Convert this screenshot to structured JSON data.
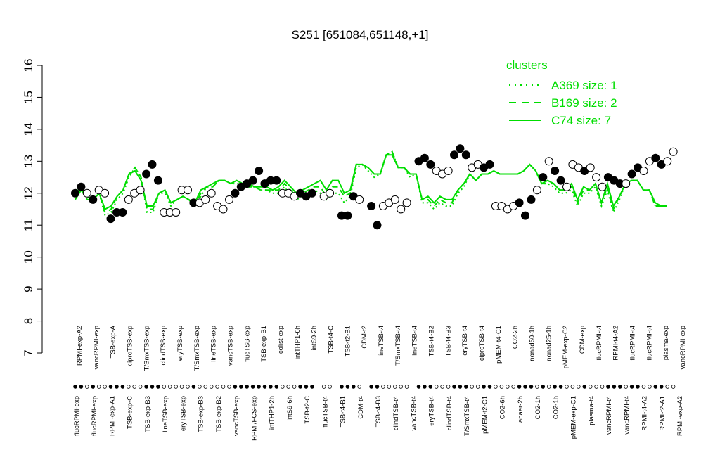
{
  "chart_data": {
    "type": "line",
    "title": "S251 [651084,651148,+1]",
    "xlabel": "",
    "ylabel": "",
    "ylim": [
      7,
      16
    ],
    "yticks": [
      "7",
      "8",
      "9",
      "10",
      "11",
      "12",
      "13",
      "14",
      "15",
      "16"
    ],
    "grid": false,
    "legend_position": "top-right",
    "colors": {
      "lines": "#00dd00",
      "points": "#000000",
      "open_points": "#ffffff"
    },
    "legend": {
      "title": "clusters",
      "entries": [
        {
          "label": "A369 size: 1",
          "style": "dotted"
        },
        {
          "label": "B169 size: 2",
          "style": "dashed"
        },
        {
          "label": "C74 size: 7",
          "style": "solid"
        }
      ]
    },
    "top_labels": [
      "RPMI-exp-A2",
      "vancRPMI-exp",
      "TSB-exp-A",
      "ciproTSB-exp",
      "T/SmxTSB-exp",
      "clindTSB-exp",
      "eryTSB-exp",
      "T/SmxTSB-exp",
      "lineTSB-exp",
      "vancTSB-exp",
      "flucTSB-exp",
      "TSB-exp-B1",
      "colist-exp",
      "intTHP1-6h",
      "intS9-2h",
      "TSB-t4-C",
      "TSB-t2-B1",
      "CDM-t2",
      "lineTSB-t4",
      "T/SmxTSB-t4",
      "lineTSB-t4",
      "TSB-t4-B2",
      "TSB-t4-B3",
      "eryTSB-t4",
      "ciproTSB-t4",
      "pMEM-t4-C1",
      "CO2-2h",
      "nonad50-1h",
      "nonad25-1h",
      "pMEM-exp-C2",
      "CDM-exp",
      "flucRPMI-t4",
      "RPMI-t4-A2",
      "flucRPMI-t4",
      "flucRPMI-t4",
      "plasma-exp",
      "vancRPMI-exp"
    ],
    "bottom_labels": [
      "flucRPMI-exp",
      "flucRPMI-exp",
      "RPMI-exp-A1",
      "TSB-exp-C",
      "TSB-exp-B3",
      "lineTSB-exp",
      "eryTSB-exp",
      "TSB-exp-B3",
      "TSB-exp-B2",
      "vancTSB-exp",
      "RPMI/FCS-exp",
      "intTHP1-2h",
      "intS9-6h",
      "TSB-t2-C",
      "flucTSB-t4",
      "TSB-t4-B1",
      "CDM-t4",
      "TSB-t4-B3",
      "clindTSB-t4",
      "vancTSB-t4",
      "eryTSB-t4",
      "clindTSB-t4",
      "T/SmxTSB-t4",
      "pMEM-t2-C1",
      "CO2-6h",
      "anaer-2h",
      "CO2-1h",
      "CO2-1h",
      "pMEM-exp-C1",
      "plasma-t4",
      "vancRPMI-t4",
      "vancRPMI-t4",
      "RPMI-t4-A2",
      "RPMI-t2-A1",
      "RPMI-exp-A2"
    ],
    "x_range": [
      1,
      100
    ],
    "series": [
      {
        "name": "C74 size: 7",
        "style": "solid",
        "values": [
          11.8,
          12.1,
          11.9,
          11.8,
          12.0,
          11.5,
          11.6,
          11.9,
          12.1,
          12.6,
          12.7,
          12.4,
          11.6,
          11.6,
          12.0,
          12.1,
          11.7,
          11.8,
          11.9,
          11.8,
          11.7,
          12.1,
          12.2,
          12.3,
          12.4,
          12.4,
          12.3,
          12.4,
          12.3,
          12.3,
          12.2,
          12.2,
          12.2,
          12.1,
          12.2,
          12.4,
          12.2,
          12.0,
          12.1,
          12.2,
          12.3,
          12.4,
          12.1,
          12.4,
          12.4,
          12.0,
          12.1,
          12.9,
          12.9,
          12.8,
          12.6,
          12.6,
          13.2,
          13.2,
          12.8,
          12.8,
          12.6,
          12.6,
          11.8,
          11.9,
          11.7,
          11.9,
          11.8,
          11.8,
          12.1,
          12.3,
          12.6,
          12.4,
          12.6,
          12.6,
          12.7,
          12.6,
          12.6,
          12.6,
          12.6,
          12.7,
          12.9,
          12.7,
          12.3,
          12.4,
          12.3,
          12.1,
          12.1,
          12.3,
          11.8,
          12.2,
          12.1,
          12.3,
          11.7,
          12.3,
          11.6,
          11.9,
          12.3,
          12.4,
          12.4,
          12.1,
          12.1,
          11.7,
          11.6,
          11.6
        ]
      },
      {
        "name": "B169 size: 2",
        "style": "dashed",
        "values": [
          11.9,
          12.1,
          11.8,
          11.8,
          12.0,
          11.4,
          11.5,
          11.9,
          12.1,
          12.6,
          12.8,
          12.5,
          11.5,
          11.5,
          12.0,
          12.1,
          11.7,
          11.8,
          11.9,
          11.8,
          11.6,
          12.0,
          12.2,
          12.2,
          12.4,
          12.4,
          12.3,
          12.4,
          12.3,
          12.2,
          12.2,
          12.1,
          12.1,
          12.1,
          12.1,
          12.3,
          12.1,
          11.9,
          12.0,
          12.1,
          12.2,
          12.2,
          11.9,
          12.2,
          12.2,
          11.9,
          12.0,
          12.9,
          12.9,
          12.8,
          12.6,
          12.6,
          13.2,
          13.3,
          12.8,
          12.8,
          12.6,
          12.6,
          11.8,
          11.8,
          11.6,
          11.8,
          11.7,
          11.7,
          12.1,
          12.3,
          12.6,
          12.4,
          12.6,
          12.6,
          12.7,
          12.6,
          12.6,
          12.6,
          12.6,
          12.7,
          12.9,
          12.7,
          12.3,
          12.3,
          12.3,
          12.1,
          12.1,
          12.2,
          11.7,
          12.1,
          12.1,
          12.3,
          11.7,
          12.2,
          11.5,
          11.9,
          12.3,
          12.4,
          12.4,
          12.1,
          12.1,
          11.6,
          11.6,
          11.6
        ]
      },
      {
        "name": "A369 size: 1",
        "style": "dotted",
        "values": [
          12.0,
          12.2,
          11.8,
          11.8,
          12.0,
          11.3,
          11.4,
          11.8,
          12.0,
          12.5,
          12.8,
          12.5,
          11.4,
          11.4,
          12.0,
          12.0,
          11.6,
          11.8,
          11.9,
          11.8,
          11.6,
          11.9,
          12.2,
          12.2,
          12.4,
          12.4,
          12.3,
          12.3,
          12.3,
          12.2,
          12.2,
          12.1,
          12.1,
          12.0,
          12.0,
          12.2,
          11.9,
          11.8,
          11.9,
          12.0,
          12.1,
          12.0,
          11.8,
          12.0,
          12.0,
          11.7,
          11.9,
          12.8,
          12.9,
          12.7,
          12.5,
          12.6,
          13.2,
          13.3,
          12.8,
          12.8,
          12.5,
          12.6,
          11.7,
          11.7,
          11.5,
          11.7,
          11.6,
          11.6,
          12.0,
          12.2,
          12.6,
          12.4,
          12.6,
          12.6,
          12.7,
          12.6,
          12.6,
          12.6,
          12.6,
          12.7,
          12.9,
          12.7,
          12.3,
          12.3,
          12.2,
          12.0,
          12.0,
          12.1,
          11.6,
          12.0,
          12.0,
          12.2,
          11.6,
          12.1,
          11.4,
          11.8,
          12.3,
          12.4,
          12.4,
          12.1,
          12.1,
          11.6,
          11.6,
          11.6
        ]
      }
    ],
    "points": [
      {
        "x": 1,
        "y": 12.0,
        "f": 1
      },
      {
        "x": 2,
        "y": 12.2,
        "f": 1
      },
      {
        "x": 3,
        "y": 12.0,
        "f": 0
      },
      {
        "x": 4,
        "y": 11.8,
        "f": 1
      },
      {
        "x": 5,
        "y": 12.1,
        "f": 0
      },
      {
        "x": 6,
        "y": 12.0,
        "f": 0
      },
      {
        "x": 7,
        "y": 11.2,
        "f": 1
      },
      {
        "x": 8,
        "y": 11.4,
        "f": 1
      },
      {
        "x": 9,
        "y": 11.4,
        "f": 1
      },
      {
        "x": 10,
        "y": 11.8,
        "f": 0
      },
      {
        "x": 11,
        "y": 12.0,
        "f": 0
      },
      {
        "x": 12,
        "y": 12.1,
        "f": 0
      },
      {
        "x": 13,
        "y": 12.6,
        "f": 1
      },
      {
        "x": 14,
        "y": 12.9,
        "f": 1
      },
      {
        "x": 15,
        "y": 12.4,
        "f": 1
      },
      {
        "x": 16,
        "y": 11.4,
        "f": 0
      },
      {
        "x": 17,
        "y": 11.4,
        "f": 0
      },
      {
        "x": 18,
        "y": 11.4,
        "f": 0
      },
      {
        "x": 19,
        "y": 12.1,
        "f": 0
      },
      {
        "x": 20,
        "y": 12.1,
        "f": 0
      },
      {
        "x": 21,
        "y": 11.7,
        "f": 1
      },
      {
        "x": 22,
        "y": 11.7,
        "f": 0
      },
      {
        "x": 23,
        "y": 11.8,
        "f": 0
      },
      {
        "x": 24,
        "y": 12.0,
        "f": 0
      },
      {
        "x": 25,
        "y": 11.6,
        "f": 0
      },
      {
        "x": 26,
        "y": 11.5,
        "f": 0
      },
      {
        "x": 27,
        "y": 11.8,
        "f": 0
      },
      {
        "x": 28,
        "y": 12.0,
        "f": 1
      },
      {
        "x": 29,
        "y": 12.2,
        "f": 1
      },
      {
        "x": 30,
        "y": 12.3,
        "f": 1
      },
      {
        "x": 31,
        "y": 12.4,
        "f": 1
      },
      {
        "x": 32,
        "y": 12.7,
        "f": 1
      },
      {
        "x": 33,
        "y": 12.3,
        "f": 1
      },
      {
        "x": 34,
        "y": 12.4,
        "f": 1
      },
      {
        "x": 35,
        "y": 12.4,
        "f": 1
      },
      {
        "x": 36,
        "y": 12.0,
        "f": 0
      },
      {
        "x": 37,
        "y": 12.0,
        "f": 0
      },
      {
        "x": 38,
        "y": 11.9,
        "f": 0
      },
      {
        "x": 39,
        "y": 12.0,
        "f": 1
      },
      {
        "x": 40,
        "y": 11.9,
        "f": 1
      },
      {
        "x": 41,
        "y": 12.0,
        "f": 1
      },
      {
        "x": 43,
        "y": 11.9,
        "f": 0
      },
      {
        "x": 44,
        "y": 12.0,
        "f": 0
      },
      {
        "x": 46,
        "y": 11.3,
        "f": 1
      },
      {
        "x": 47,
        "y": 11.3,
        "f": 1
      },
      {
        "x": 48,
        "y": 11.9,
        "f": 1
      },
      {
        "x": 49,
        "y": 11.8,
        "f": 0
      },
      {
        "x": 51,
        "y": 11.6,
        "f": 1
      },
      {
        "x": 52,
        "y": 11.0,
        "f": 1
      },
      {
        "x": 53,
        "y": 11.6,
        "f": 0
      },
      {
        "x": 54,
        "y": 11.7,
        "f": 0
      },
      {
        "x": 55,
        "y": 11.8,
        "f": 0
      },
      {
        "x": 56,
        "y": 11.5,
        "f": 0
      },
      {
        "x": 57,
        "y": 11.7,
        "f": 0
      },
      {
        "x": 59,
        "y": 13.0,
        "f": 1
      },
      {
        "x": 60,
        "y": 13.1,
        "f": 1
      },
      {
        "x": 61,
        "y": 12.9,
        "f": 1
      },
      {
        "x": 62,
        "y": 12.7,
        "f": 0
      },
      {
        "x": 63,
        "y": 12.6,
        "f": 0
      },
      {
        "x": 64,
        "y": 12.7,
        "f": 0
      },
      {
        "x": 65,
        "y": 13.2,
        "f": 1
      },
      {
        "x": 66,
        "y": 13.4,
        "f": 1
      },
      {
        "x": 67,
        "y": 13.2,
        "f": 1
      },
      {
        "x": 68,
        "y": 12.8,
        "f": 0
      },
      {
        "x": 69,
        "y": 12.9,
        "f": 0
      },
      {
        "x": 70,
        "y": 12.8,
        "f": 1
      },
      {
        "x": 71,
        "y": 12.9,
        "f": 1
      },
      {
        "x": 72,
        "y": 11.6,
        "f": 0
      },
      {
        "x": 73,
        "y": 11.6,
        "f": 0
      },
      {
        "x": 74,
        "y": 11.5,
        "f": 0
      },
      {
        "x": 75,
        "y": 11.6,
        "f": 0
      },
      {
        "x": 76,
        "y": 11.7,
        "f": 1
      },
      {
        "x": 77,
        "y": 11.3,
        "f": 1
      },
      {
        "x": 78,
        "y": 11.8,
        "f": 1
      },
      {
        "x": 79,
        "y": 12.1,
        "f": 0
      },
      {
        "x": 80,
        "y": 12.5,
        "f": 1
      },
      {
        "x": 81,
        "y": 13.0,
        "f": 0
      },
      {
        "x": 82,
        "y": 12.7,
        "f": 1
      },
      {
        "x": 83,
        "y": 12.4,
        "f": 1
      },
      {
        "x": 84,
        "y": 12.2,
        "f": 0
      },
      {
        "x": 85,
        "y": 12.9,
        "f": 0
      },
      {
        "x": 86,
        "y": 12.8,
        "f": 0
      },
      {
        "x": 87,
        "y": 12.7,
        "f": 1
      },
      {
        "x": 88,
        "y": 12.8,
        "f": 0
      },
      {
        "x": 89,
        "y": 12.5,
        "f": 0
      },
      {
        "x": 90,
        "y": 12.2,
        "f": 0
      },
      {
        "x": 91,
        "y": 12.5,
        "f": 1
      },
      {
        "x": 92,
        "y": 12.4,
        "f": 1
      },
      {
        "x": 93,
        "y": 12.3,
        "f": 1
      },
      {
        "x": 94,
        "y": 12.3,
        "f": 0
      },
      {
        "x": 95,
        "y": 12.6,
        "f": 1
      },
      {
        "x": 96,
        "y": 12.8,
        "f": 1
      },
      {
        "x": 97,
        "y": 12.7,
        "f": 0
      },
      {
        "x": 98,
        "y": 13.0,
        "f": 0
      },
      {
        "x": 99,
        "y": 13.1,
        "f": 1
      },
      {
        "x": 100,
        "y": 12.9,
        "f": 1
      },
      {
        "x": 101,
        "y": 13.0,
        "f": 0
      },
      {
        "x": 102,
        "y": 13.3,
        "f": 0
      }
    ]
  }
}
